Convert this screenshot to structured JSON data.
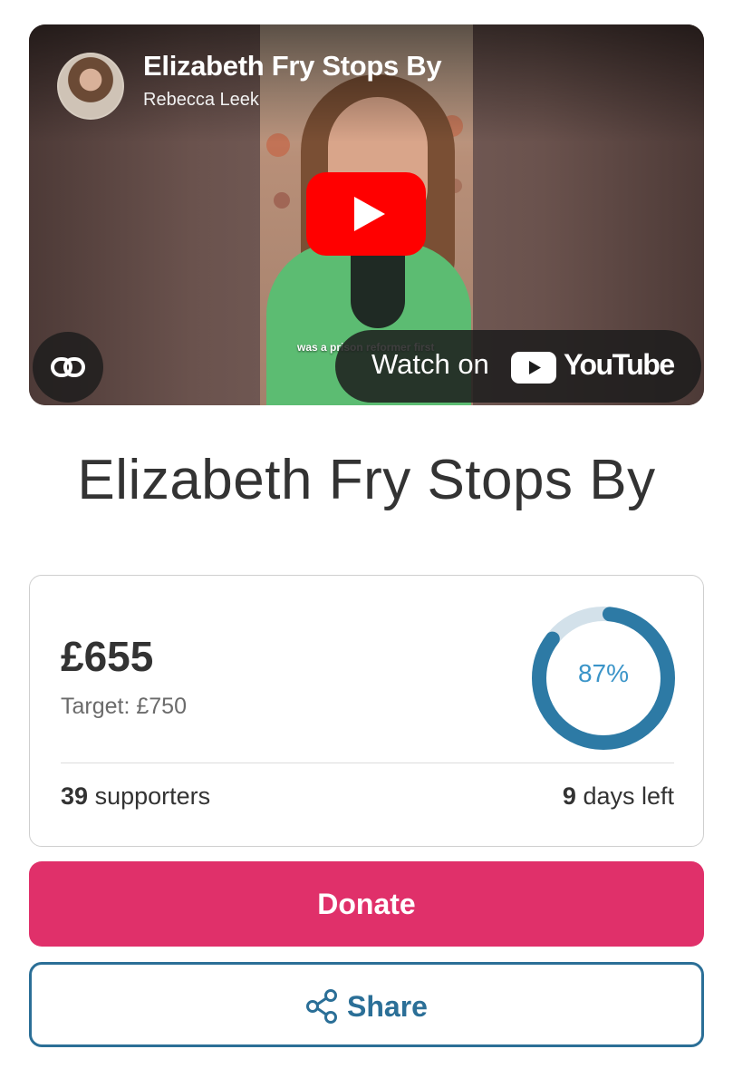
{
  "video": {
    "title": "Elizabeth Fry Stops By",
    "channel": "Rebecca Leek",
    "caption": "was a prison reformer first",
    "watch_on_label": "Watch on",
    "youtube_wordmark": "YouTube",
    "brand_color": "#ff0000",
    "icons": [
      "play-icon",
      "link-icon",
      "youtube-logo-icon"
    ]
  },
  "page": {
    "title": "Elizabeth Fry Stops By"
  },
  "stats": {
    "raised": "£655",
    "target": "Target: £750",
    "progress_percent_label": "87%",
    "progress_fraction": 0.87,
    "supporters_count": "39",
    "supporters_label": "supporters",
    "days_count": "9",
    "days_label": "days left",
    "ring_color": "#2d7aa5",
    "ring_track_color": "#d3e1ea"
  },
  "actions": {
    "donate_label": "Donate",
    "donate_color": "#e0306a",
    "share_label": "Share",
    "share_color": "#2b6f97",
    "share_icon": "share-icon"
  }
}
